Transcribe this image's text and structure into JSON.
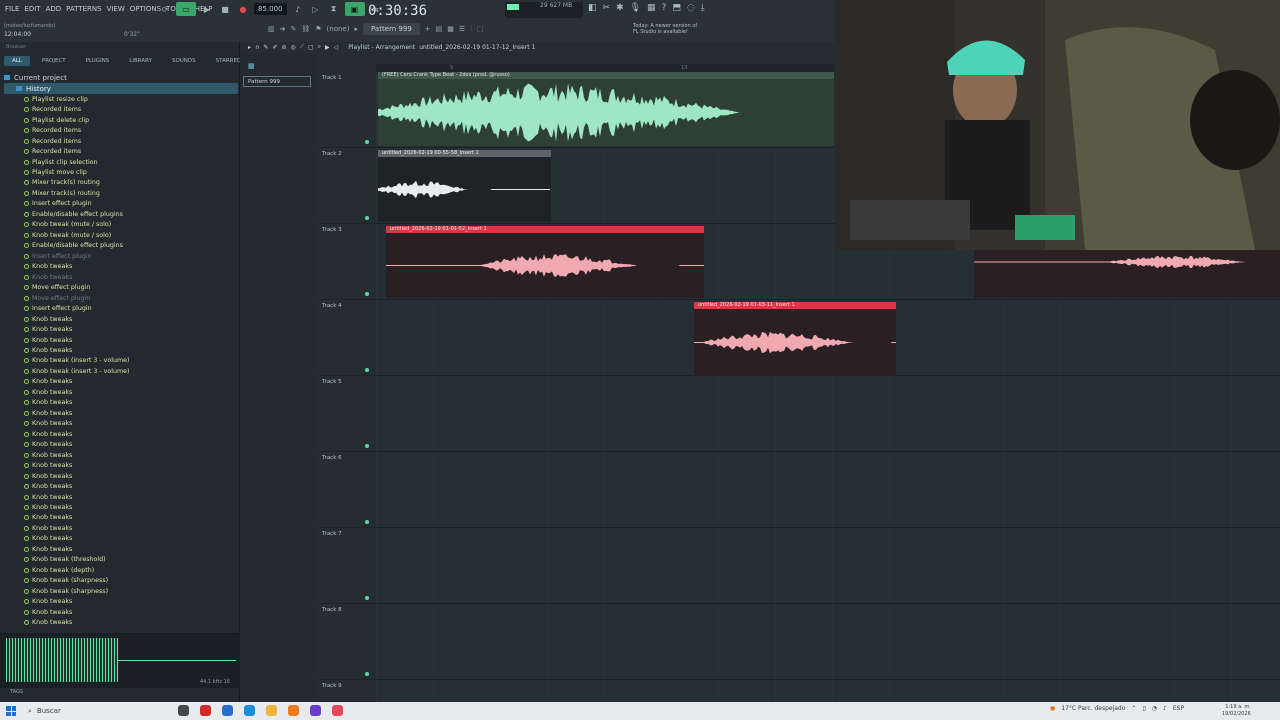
{
  "menu": [
    "FILE",
    "EDIT",
    "ADD",
    "PATTERNS",
    "VIEW",
    "OPTIONS",
    "TOOLS",
    "HELP"
  ],
  "transport": {
    "tempo": "85.000",
    "time": "0:30:36",
    "cpu_value": "29",
    "mem": "627 MB"
  },
  "pattern_selector": "Pattern 999",
  "mixer_select": "(none)",
  "notice": {
    "line1": "Today: A newer version of",
    "line2": "FL Studio is available!"
  },
  "left_info": {
    "user": "(mateo/lucfumando)",
    "time": "12:04:00",
    "val": "0'32\""
  },
  "browser": {
    "title": "Browser",
    "tabs": [
      "ALL",
      "PROJECT",
      "PLUGINS",
      "LIBRARY",
      "SOUNDS",
      "STARRED"
    ],
    "current_project": "Current project",
    "history": "History",
    "items": [
      "Playlist resize clip",
      "Recorded items",
      "Playlist delete clip",
      "Recorded items",
      "Recorded items",
      "Recorded items",
      "Playlist clip selection",
      "Playlist move clip",
      "Mixer track(s) routing",
      "Mixer track(s) routing",
      "Insert effect plugin",
      "Enable/disable effect plugins",
      "Knob tweak (mute / solo)",
      "Knob tweak (mute / solo)",
      "Enable/disable effect plugins",
      "Insert effect plugin",
      "Knob tweaks",
      "Knob tweaks",
      "Move effect plugin",
      "Move effect plugin",
      "Insert effect plugin",
      "Knob tweaks",
      "Knob tweaks",
      "Knob tweaks",
      "Knob tweaks",
      "Knob tweak (insert 3 - volume)",
      "Knob tweak (insert 3 - volume)",
      "Knob tweaks",
      "Knob tweaks",
      "Knob tweaks",
      "Knob tweaks",
      "Knob tweaks",
      "Knob tweaks",
      "Knob tweaks",
      "Knob tweaks",
      "Knob tweaks",
      "Knob tweaks",
      "Knob tweaks",
      "Knob tweaks",
      "Knob tweaks",
      "Knob tweaks",
      "Knob tweaks",
      "Knob tweaks",
      "Knob tweaks",
      "Knob tweak (threshold)",
      "Knob tweak (depth)",
      "Knob tweak (sharpness)",
      "Knob tweak (sharpness)",
      "Knob tweaks",
      "Knob tweaks",
      "Knob tweaks"
    ],
    "scope_info": "44.1 kHz 16",
    "tags": "TAGS"
  },
  "playlist": {
    "title": "Playlist - Arrangement",
    "file": "untitled_2026-02-19 01-17-12_Insert 1",
    "pattern_item": "Pattern 999",
    "ruler": [
      "9",
      "13"
    ],
    "tracks": [
      "Track 1",
      "Track 2",
      "Track 3",
      "Track 4",
      "Track 5",
      "Track 6",
      "Track 7",
      "Track 8",
      "Track 9"
    ],
    "clips": [
      {
        "label": "(FREE) Cero  Crank Type Beat - 2dos (prod. @russo)"
      },
      {
        "label": "untitled_2026-02-19 00-55-58_Insert 1"
      },
      {
        "label": "untitled_2026-02-19 01-01-52_Insert 1"
      },
      {
        "label": "untitled_2026-02-19 01-03-11_Insert 1"
      }
    ]
  },
  "taskbar": {
    "search": "Buscar",
    "weather": "17°C Parc. despejado",
    "lang": "ESP",
    "clock_time": "1:19 a. m.",
    "clock_date": "19/02/2026"
  },
  "colors": {
    "accent": "#6ff0b0",
    "clip_red": "#d03b48",
    "history_text": "#d9e3a0"
  }
}
